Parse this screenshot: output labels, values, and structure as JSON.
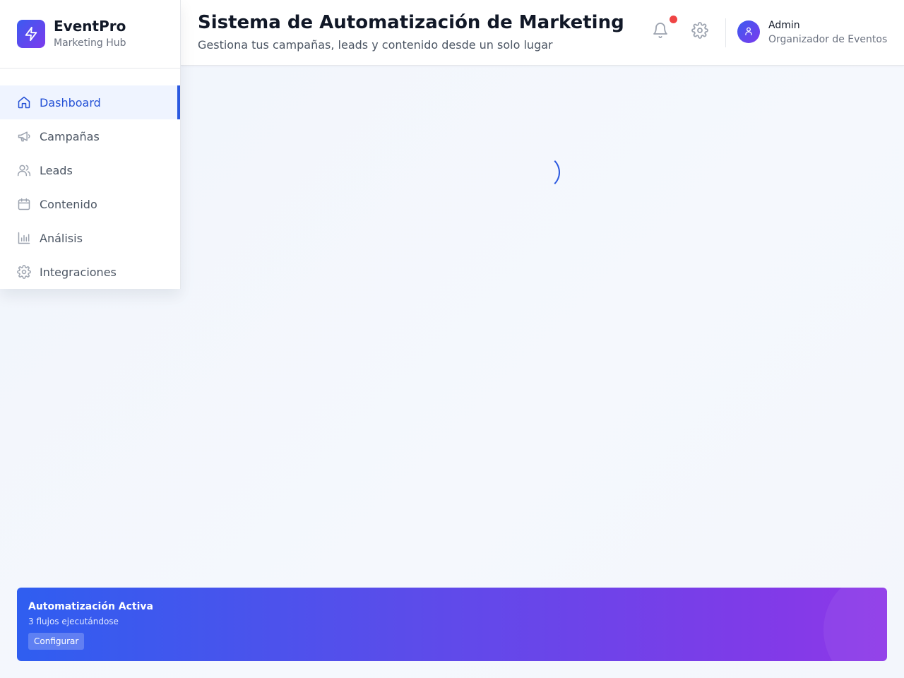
{
  "brand": {
    "name": "EventPro",
    "subtitle": "Marketing Hub",
    "logo_icon": "lightning-icon"
  },
  "sidebar": {
    "items": [
      {
        "label": "Dashboard",
        "icon": "home-icon",
        "active": true
      },
      {
        "label": "Campañas",
        "icon": "megaphone-icon",
        "active": false
      },
      {
        "label": "Leads",
        "icon": "users-icon",
        "active": false
      },
      {
        "label": "Contenido",
        "icon": "calendar-icon",
        "active": false
      },
      {
        "label": "Análisis",
        "icon": "bar-chart-icon",
        "active": false
      },
      {
        "label": "Integraciones",
        "icon": "gear-icon",
        "active": false
      }
    ]
  },
  "header": {
    "title": "Sistema de Automatización de Marketing",
    "subtitle": "Gestiona tus campañas, leads y contenido desde un solo lugar",
    "notifications_unread": true,
    "user": {
      "name": "Admin",
      "role": "Organizador de Eventos"
    }
  },
  "main": {
    "loading": true
  },
  "automation_banner": {
    "title": "Automatización Activa",
    "description": "3 flujos ejecutándose",
    "button_label": "Configurar"
  },
  "colors": {
    "accent": "#2b59e0",
    "brand_gradient_start": "#3b5bf0",
    "brand_gradient_end": "#7c3aed",
    "notification": "#ef4444"
  }
}
